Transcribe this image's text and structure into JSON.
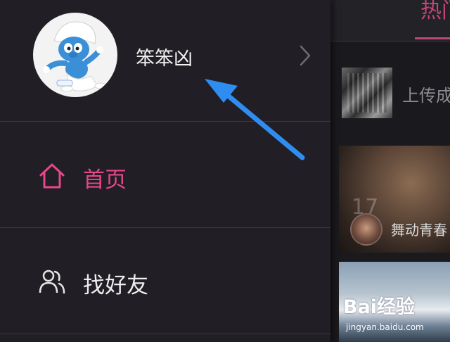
{
  "main": {
    "tab_label": "热门",
    "upload_label": "上传成",
    "cards": [
      {
        "caption": "舞动青春",
        "overlay_number": "17"
      },
      {
        "caption": ""
      }
    ]
  },
  "drawer": {
    "username": "笨笨凶",
    "menu": [
      {
        "label": "首页",
        "icon": "home-icon",
        "active": true
      },
      {
        "label": "找好友",
        "icon": "friends-icon",
        "active": false
      }
    ]
  },
  "colors": {
    "accent": "#e8468a",
    "arrow": "#2f8df2",
    "drawer_bg": "#211f25"
  },
  "watermark": {
    "brand": "Bai经验",
    "url": "jingyan.baidu.com"
  }
}
